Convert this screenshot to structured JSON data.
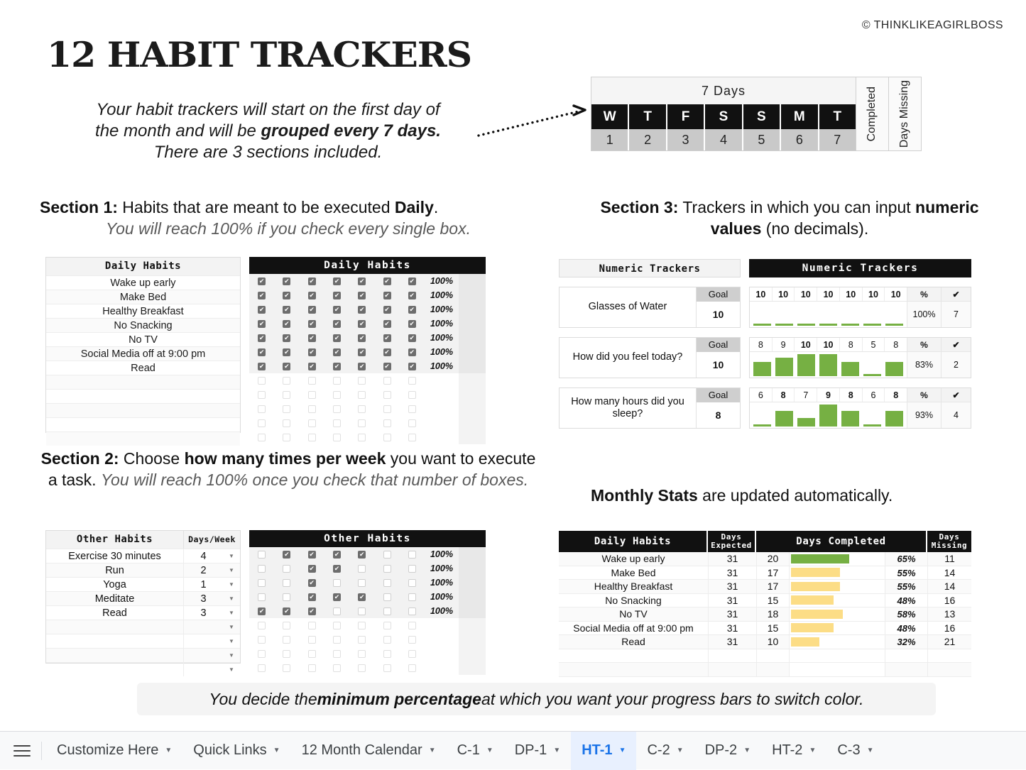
{
  "copyright": "© THINKLIKEAGIRLBOSS",
  "title": "12 HABIT TRACKERS",
  "intro": {
    "line1": "Your habit trackers will start on the first day of",
    "line2a": "the month and will be ",
    "line2b": "grouped every 7 days.",
    "line3": "There are 3 sections included."
  },
  "seven_days": {
    "title": "7  Days",
    "day_letters": [
      "W",
      "T",
      "F",
      "S",
      "S",
      "M",
      "T"
    ],
    "day_numbers": [
      "1",
      "2",
      "3",
      "4",
      "5",
      "6",
      "7"
    ],
    "completed_label": "Completed",
    "days_missing_label": "Days Missing"
  },
  "section1": {
    "head_bold": "Section 1:",
    "head_rest": " Habits that are meant to be executed ",
    "head_strong": "Daily",
    "head_end": ".",
    "sub": "You will reach 100% if you check every single box.",
    "left_header": "Daily Habits",
    "right_header": "Daily Habits",
    "habits": [
      "Wake up early",
      "Make Bed",
      "Healthy Breakfast",
      "No Snacking",
      "No TV",
      "Social Media off at 9:00 pm",
      "Read"
    ],
    "empty_rows": 5,
    "percent_value": "100%",
    "checked_rows": 7,
    "empty_check_rows": 5,
    "columns": 7
  },
  "section2": {
    "head_bold": "Section 2:",
    "head_rest": " Choose ",
    "head_strong": "how many times per week",
    "head_rest2": " you want to execute a task. ",
    "sub": "You will reach 100% once you check that number of boxes.",
    "left_header": "Other Habits",
    "days_week_header": "Days/Week",
    "right_header": "Other Habits",
    "rows": [
      {
        "name": "Exercise 30 minutes",
        "days": "4",
        "checks": [
          0,
          1,
          1,
          1,
          1,
          0,
          0
        ],
        "pct": "100%"
      },
      {
        "name": "Run",
        "days": "2",
        "checks": [
          0,
          0,
          1,
          1,
          0,
          0,
          0
        ],
        "pct": "100%"
      },
      {
        "name": "Yoga",
        "days": "1",
        "checks": [
          0,
          0,
          1,
          0,
          0,
          0,
          0
        ],
        "pct": "100%"
      },
      {
        "name": "Meditate",
        "days": "3",
        "checks": [
          0,
          0,
          1,
          1,
          1,
          0,
          0
        ],
        "pct": "100%"
      },
      {
        "name": "Read",
        "days": "3",
        "checks": [
          1,
          1,
          1,
          0,
          0,
          0,
          0
        ],
        "pct": "100%"
      }
    ],
    "empty_rows": 4
  },
  "section3": {
    "head_bold": "Section 3:",
    "head_rest": " Trackers in which you can input ",
    "head_strong": "numeric values",
    "head_end": " (no decimals).",
    "left_header": "Numeric Trackers",
    "right_header": "Numeric Trackers",
    "goal_label": "Goal",
    "pct_header": "%",
    "check_header": "✔",
    "trackers": [
      {
        "question": "Glasses of Water",
        "goal": "10",
        "values": [
          "10",
          "10",
          "10",
          "10",
          "10",
          "10",
          "10"
        ],
        "bold": [
          1,
          1,
          1,
          1,
          1,
          1,
          1
        ],
        "percent": "100%",
        "checks": "7"
      },
      {
        "question": "How did you feel today?",
        "goal": "10",
        "values": [
          "8",
          "9",
          "10",
          "10",
          "8",
          "5",
          "8"
        ],
        "bold": [
          0,
          0,
          1,
          1,
          0,
          0,
          0
        ],
        "percent": "83%",
        "checks": "2"
      },
      {
        "question": "How many hours did you sleep?",
        "goal": "8",
        "values": [
          "6",
          "8",
          "7",
          "9",
          "8",
          "6",
          "8"
        ],
        "bold": [
          0,
          1,
          0,
          1,
          1,
          0,
          1
        ],
        "percent": "93%",
        "checks": "4"
      }
    ]
  },
  "monthly_stats": {
    "head_bold": "Monthly Stats",
    "head_rest": " are updated automatically.",
    "columns": [
      "Daily Habits",
      "Days Expected",
      "Days Completed",
      "Days Missing"
    ],
    "rows": [
      {
        "name": "Wake up early",
        "expected": "31",
        "completed": "20",
        "percent": "65%",
        "missing": "11",
        "color": "green"
      },
      {
        "name": "Make Bed",
        "expected": "31",
        "completed": "17",
        "percent": "55%",
        "missing": "14",
        "color": "yellow"
      },
      {
        "name": "Healthy Breakfast",
        "expected": "31",
        "completed": "17",
        "percent": "55%",
        "missing": "14",
        "color": "yellow"
      },
      {
        "name": "No Snacking",
        "expected": "31",
        "completed": "15",
        "percent": "48%",
        "missing": "16",
        "color": "yellow"
      },
      {
        "name": "No TV",
        "expected": "31",
        "completed": "18",
        "percent": "58%",
        "missing": "13",
        "color": "yellow"
      },
      {
        "name": "Social Media off at 9:00 pm",
        "expected": "31",
        "completed": "15",
        "percent": "48%",
        "missing": "16",
        "color": "yellow"
      },
      {
        "name": "Read",
        "expected": "31",
        "completed": "10",
        "percent": "32%",
        "missing": "21",
        "color": "yellow"
      }
    ],
    "empty_rows": 2
  },
  "note": {
    "a": "You decide the ",
    "b": "minimum percentage",
    "c": " at which you want your progress bars to switch color."
  },
  "colors": {
    "green_bar": "#76b043",
    "yellow_bar": "#fcdd86",
    "active_tab_text": "#1a73e8",
    "active_tab_bg": "#e8f0fe"
  },
  "tabbar": {
    "menu_icon": "hamburger-icon",
    "tabs": [
      {
        "label": "Customize Here",
        "active": false
      },
      {
        "label": "Quick Links",
        "active": false
      },
      {
        "label": "12 Month Calendar",
        "active": false
      },
      {
        "label": "C-1",
        "active": false
      },
      {
        "label": "DP-1",
        "active": false
      },
      {
        "label": "HT-1",
        "active": true
      },
      {
        "label": "C-2",
        "active": false
      },
      {
        "label": "DP-2",
        "active": false
      },
      {
        "label": "HT-2",
        "active": false
      },
      {
        "label": "C-3",
        "active": false
      }
    ]
  }
}
